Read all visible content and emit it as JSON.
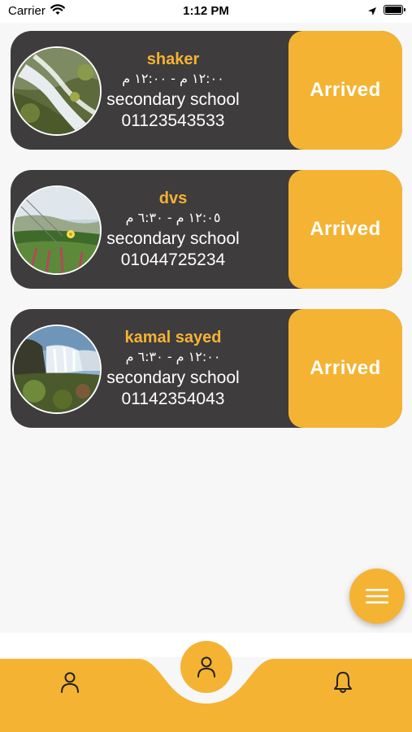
{
  "status_bar": {
    "carrier": "Carrier",
    "time": "1:12 PM"
  },
  "cards": [
    {
      "name": "shaker",
      "time_range": "١٢:٠٠ م - ١٢:٠٠ م",
      "school": "secondary school",
      "phone": "01123543533",
      "status": "Arrived",
      "image": "waterfall-moss-photo"
    },
    {
      "name": "dvs",
      "time_range": "١٢:٠٥ م - ٦:٣٠ م",
      "school": "secondary school",
      "phone": "01044725234",
      "status": "Arrived",
      "image": "coastal-flowers-photo"
    },
    {
      "name": "kamal sayed",
      "time_range": "١٢:٠٠ م - ٦:٣٠ م",
      "school": "secondary school",
      "phone": "01142354043",
      "status": "Arrived",
      "image": "waterfall-cliff-photo"
    }
  ],
  "fab": {
    "icon": "menu-icon"
  },
  "bottom_nav": {
    "items": [
      {
        "icon": "person-icon"
      },
      {
        "icon": "person-icon",
        "active": true
      },
      {
        "icon": "bell-icon"
      }
    ]
  },
  "colors": {
    "accent": "#f5b334",
    "card_background": "#3f3c3d",
    "page_background": "#f7f7f7"
  }
}
